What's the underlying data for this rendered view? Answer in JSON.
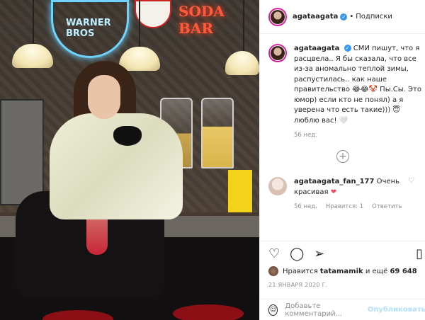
{
  "header": {
    "username": "agataagata",
    "verified_icon": "verified-badge-icon",
    "separator": "•",
    "follow_label": "Подписки"
  },
  "post": {
    "username": "agataagata",
    "caption": "СМИ пишут, что я расцвела.. Я бы сказала, что все из-за аномально теплой зимы, распустилась.. как наше правительство 😂😂🤡 Пы.Сы. Это юмор) если кто не понял) а я уверена что есть такие))) 😇 люблю вас! 🤍",
    "time": "56 нед."
  },
  "comment": {
    "username": "agataagata_fan_177",
    "text": "Очень красивая",
    "time": "56 нед.",
    "likes_label": "Нравится: 1",
    "reply_label": "Ответить"
  },
  "actions": {
    "like_icon": "heart-icon",
    "comment_icon": "comment-icon",
    "share_icon": "share-icon",
    "save_icon": "bookmark-icon"
  },
  "likes": {
    "prefix": "Нравится",
    "user": "tatamamik",
    "middle": "и ещё",
    "count": "69 648"
  },
  "date": "21 ЯНВАРЯ 2020 Г.",
  "composer": {
    "placeholder": "Добавьте комментарий...",
    "publish_label": "Опубликовать"
  },
  "photo": {
    "sign_text": "WARNER BROS",
    "soda_text": "SODA BAR"
  }
}
